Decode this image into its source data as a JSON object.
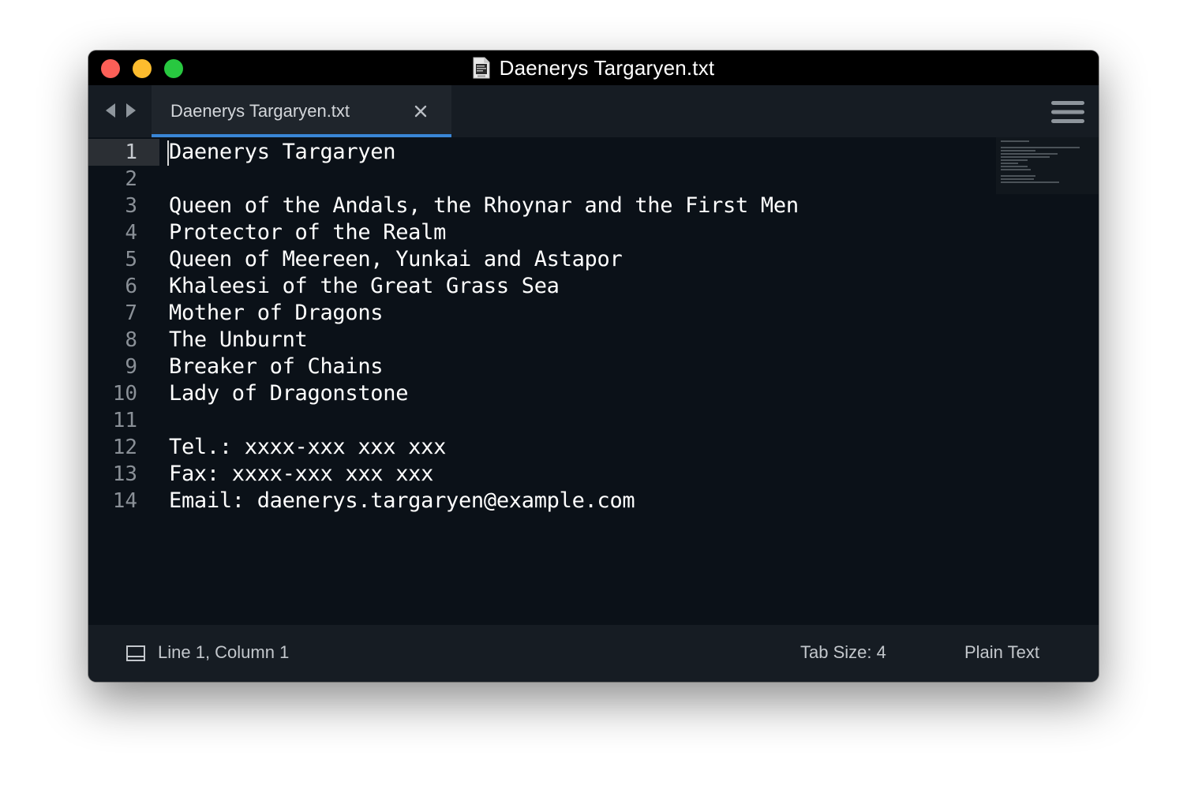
{
  "window": {
    "title": "Daenerys Targaryen.txt",
    "traffic_colors": {
      "close": "#fc5f57",
      "minimize": "#fdbc2e",
      "maximize": "#28c840"
    }
  },
  "tabs": [
    {
      "label": "Daenerys Targaryen.txt",
      "active": true,
      "close_icon": "close-icon"
    }
  ],
  "navigation": {
    "back_icon": "left-arrow-icon",
    "forward_icon": "right-arrow-icon",
    "menu_icon": "hamburger-menu-icon"
  },
  "editor": {
    "active_line": 1,
    "lines": [
      {
        "number": "1",
        "text": "Daenerys Targaryen"
      },
      {
        "number": "2",
        "text": ""
      },
      {
        "number": "3",
        "text": "Queen of the Andals, the Rhoynar and the First Men"
      },
      {
        "number": "4",
        "text": "Protector of the Realm"
      },
      {
        "number": "5",
        "text": "Queen of Meereen, Yunkai and Astapor"
      },
      {
        "number": "6",
        "text": "Khaleesi of the Great Grass Sea"
      },
      {
        "number": "7",
        "text": "Mother of Dragons"
      },
      {
        "number": "8",
        "text": "The Unburnt"
      },
      {
        "number": "9",
        "text": "Breaker of Chains"
      },
      {
        "number": "10",
        "text": "Lady of Dragonstone"
      },
      {
        "number": "11",
        "text": ""
      },
      {
        "number": "12",
        "text": "Tel.: xxxx-xxx xxx xxx"
      },
      {
        "number": "13",
        "text": "Fax: xxxx-xxx xxx xxx"
      },
      {
        "number": "14",
        "text": "Email: daenerys.targaryen@example.com"
      }
    ]
  },
  "statusbar": {
    "panel_icon": "panel-toggle-icon",
    "position": "Line 1, Column 1",
    "tab_size": "Tab Size: 4",
    "syntax": "Plain Text"
  },
  "colors": {
    "editor_background": "#0b1118",
    "tab_active_underline": "#3a86d6",
    "text": "#ffffff",
    "line_number": "#8a9097"
  }
}
